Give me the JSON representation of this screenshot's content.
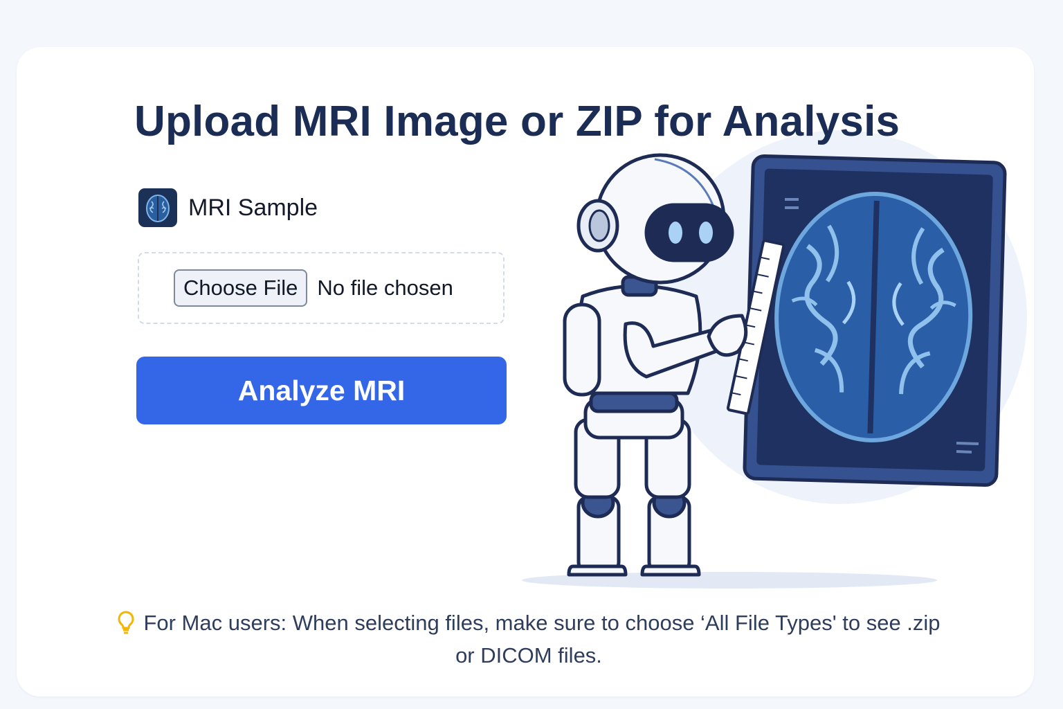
{
  "page": {
    "title": "Upload MRI Image or ZIP for Analysis"
  },
  "sample": {
    "label": "MRI Sample",
    "icon": "brain-scan-thumbnail"
  },
  "file_input": {
    "button_label": "Choose File",
    "status_text": "No file chosen"
  },
  "analyze": {
    "label": "Analyze MRI"
  },
  "tip": {
    "icon": "lightbulb-icon",
    "text": "For Mac users: When selecting files, make sure to choose ‘All File Types' to see .zip or DICOM files."
  },
  "colors": {
    "accent": "#3466e8",
    "title": "#1b2d55",
    "tip_text": "#2f3d5c",
    "tip_icon": "#f2b705",
    "page_bg": "#f4f7fc",
    "card_bg": "#ffffff"
  }
}
